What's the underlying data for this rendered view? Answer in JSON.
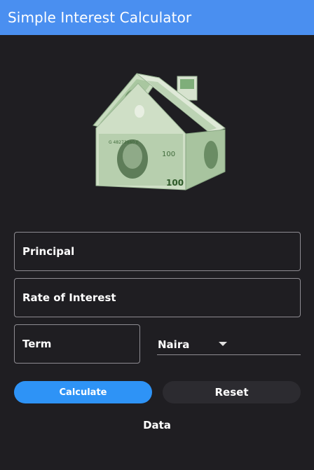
{
  "app": {
    "title": "Simple Interest Calculator"
  },
  "form": {
    "principal_placeholder": "Principal",
    "rate_placeholder": "Rate of Interest",
    "term_placeholder": "Term",
    "currency_selected": "Naira"
  },
  "actions": {
    "calculate_label": "Calculate",
    "reset_label": "Reset"
  },
  "result": {
    "text": "Data"
  },
  "colors": {
    "appbar": "#4a8ff0",
    "background": "#1f1e22",
    "primary_button": "#2e93f6",
    "secondary_button": "#2c2b30"
  },
  "icons": {
    "hero": "money-house-image",
    "dropdown": "dropdown-arrow-icon"
  }
}
